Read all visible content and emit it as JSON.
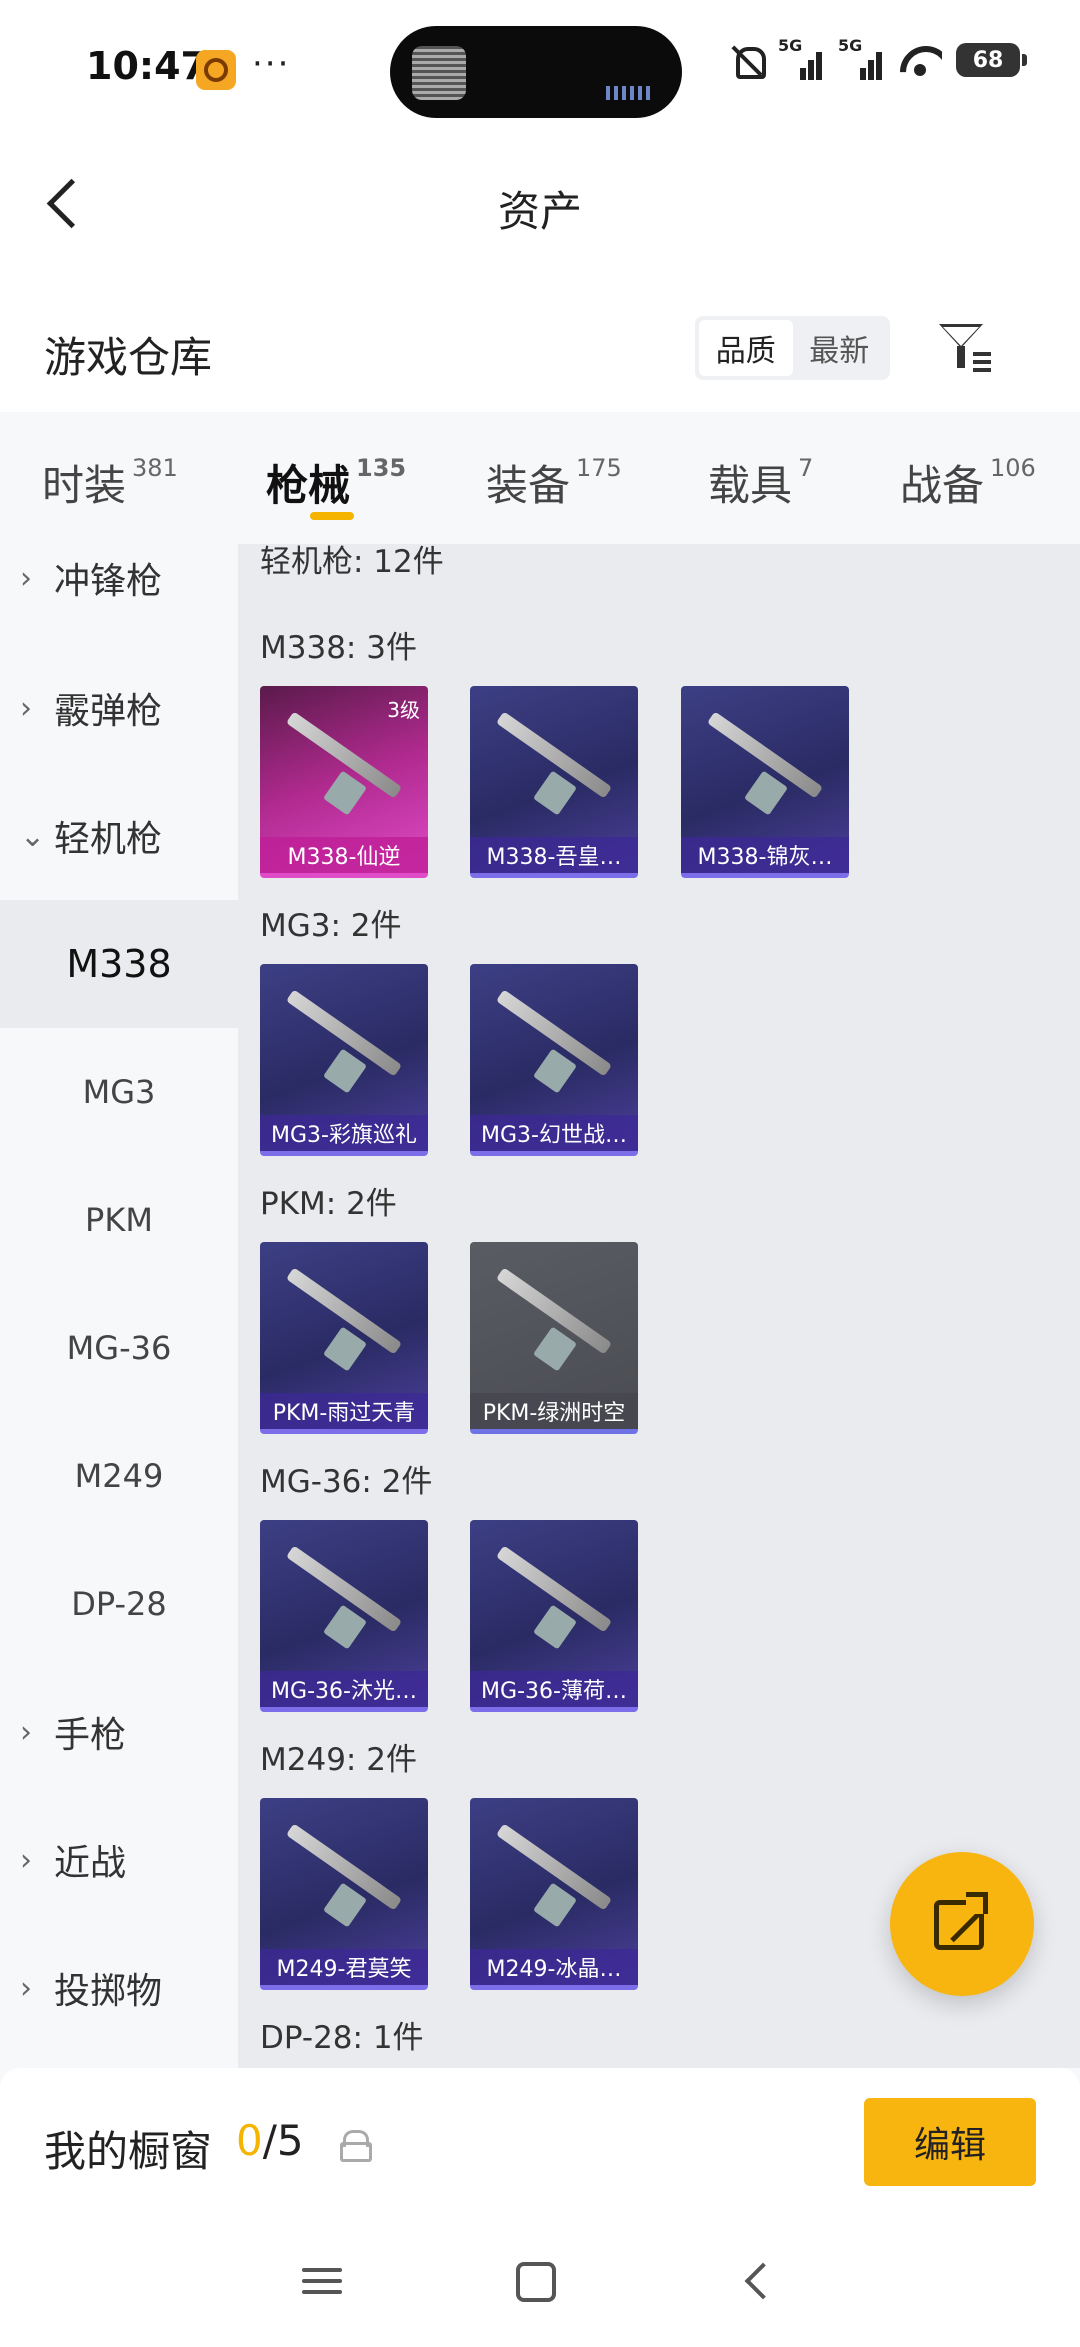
{
  "status_bar": {
    "time": "10:47",
    "dots": "···",
    "signal1_label": "5G",
    "signal2_label": "5G",
    "battery": "68"
  },
  "header": {
    "title": "资产"
  },
  "warehouse": {
    "title": "游戏仓库",
    "sort_options": [
      "品质",
      "最新"
    ],
    "sort_selected": "品质"
  },
  "tabs": [
    {
      "label": "时装",
      "count": "381"
    },
    {
      "label": "枪械",
      "count": "135"
    },
    {
      "label": "装备",
      "count": "175"
    },
    {
      "label": "载具",
      "count": "7"
    },
    {
      "label": "战备",
      "count": "106"
    }
  ],
  "sidebar": {
    "categories": [
      {
        "label": "冲锋枪",
        "expanded": false
      },
      {
        "label": "霰弹枪",
        "expanded": false
      },
      {
        "label": "轻机枪",
        "expanded": true
      }
    ],
    "subitems": [
      "M338",
      "MG3",
      "PKM",
      "MG-36",
      "M249",
      "DP-28"
    ],
    "active_subitem": "M338",
    "more_categories": [
      {
        "label": "手枪"
      },
      {
        "label": "近战"
      },
      {
        "label": "投掷物"
      }
    ]
  },
  "content": {
    "section_header": "轻机枪: 12件",
    "groups": [
      {
        "title": "M338: 3件",
        "items": [
          {
            "name": "M338-仙逆",
            "level": "3级",
            "tier": "gold"
          },
          {
            "name": "M338-吾皇…",
            "tier": "purple"
          },
          {
            "name": "M338-锦灰…",
            "tier": "purple"
          }
        ]
      },
      {
        "title": "MG3: 2件",
        "items": [
          {
            "name": "MG3-彩旗巡礼",
            "tier": "purple"
          },
          {
            "name": "MG3-幻世战…",
            "tier": "purple"
          }
        ]
      },
      {
        "title": "PKM: 2件",
        "items": [
          {
            "name": "PKM-雨过天青",
            "tier": "purple"
          },
          {
            "name": "PKM-绿洲时空",
            "tier": "grey"
          }
        ]
      },
      {
        "title": "MG-36: 2件",
        "items": [
          {
            "name": "MG-36-沐光…",
            "tier": "purple"
          },
          {
            "name": "MG-36-薄荷…",
            "tier": "purple"
          }
        ]
      },
      {
        "title": "M249: 2件",
        "items": [
          {
            "name": "M249-君莫笑",
            "tier": "purple"
          },
          {
            "name": "M249-冰晶…",
            "tier": "purple"
          }
        ]
      },
      {
        "title": "DP-28: 1件",
        "items": []
      }
    ]
  },
  "showcase": {
    "label": "我的橱窗",
    "current": "0",
    "separator_total": "/5",
    "edit_label": "编辑"
  },
  "colors": {
    "accent": "#f8b40f",
    "card_purple": "#3d3f85",
    "card_gold": "#b02a8f"
  }
}
